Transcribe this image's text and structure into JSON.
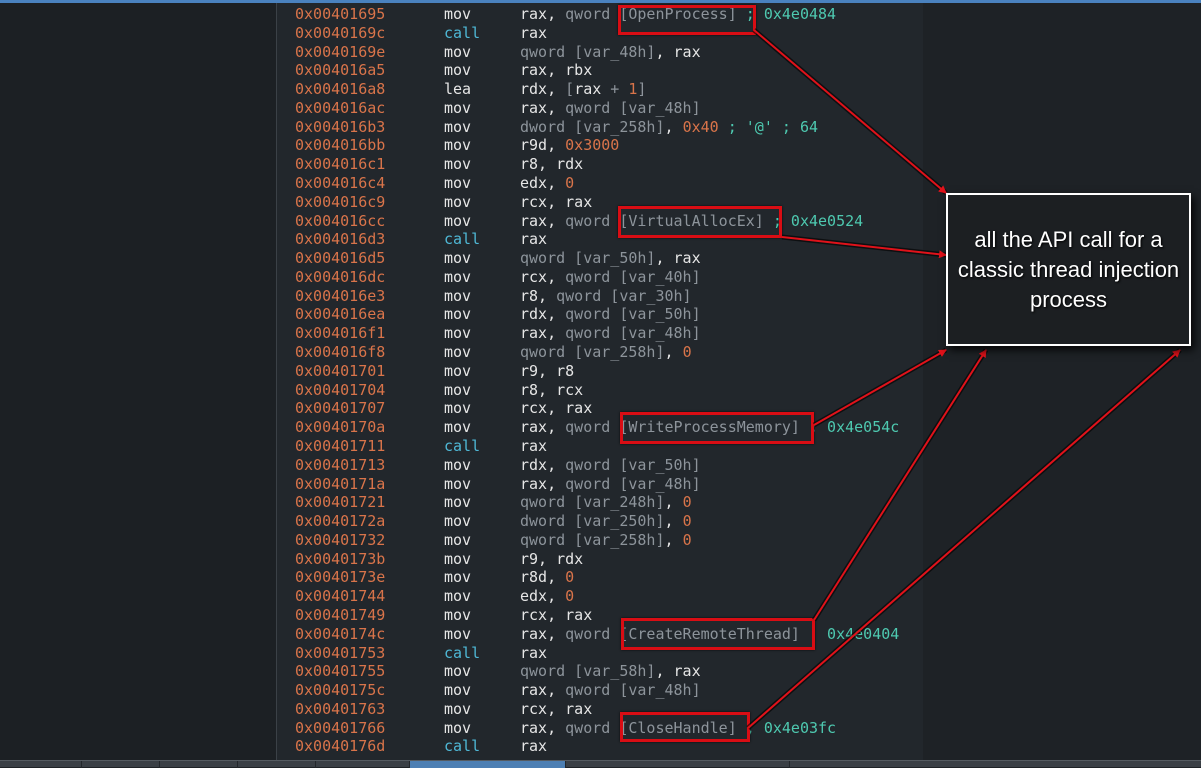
{
  "colors": {
    "address": "#d9744a",
    "mnemonic": "#e6e6e6",
    "call_mnemonic": "#4fb8d6",
    "size_keyword": "#8d949b",
    "comment": "#4ec9b0",
    "annotation_red": "#d90d14"
  },
  "annotation": {
    "text": "all the API call for a classic thread injection process"
  },
  "lines": [
    {
      "addr": "0x00401695",
      "mn": "mov",
      "ops": [
        {
          "t": "rax, ",
          "c": "op"
        },
        {
          "t": "qword ",
          "c": "kw"
        },
        {
          "t": "[OpenProcess]",
          "c": "kw"
        },
        {
          "t": " ; 0x4e0484",
          "c": "cm"
        }
      ]
    },
    {
      "addr": "0x0040169c",
      "mn": "call",
      "ops": [
        {
          "t": "rax",
          "c": "op"
        }
      ]
    },
    {
      "addr": "0x0040169e",
      "mn": "mov",
      "ops": [
        {
          "t": "qword [var_48h]",
          "c": "kw"
        },
        {
          "t": ", rax",
          "c": "op"
        }
      ]
    },
    {
      "addr": "0x004016a5",
      "mn": "mov",
      "ops": [
        {
          "t": "rax, rbx",
          "c": "op"
        }
      ]
    },
    {
      "addr": "0x004016a8",
      "mn": "lea",
      "ops": [
        {
          "t": "rdx, ",
          "c": "op"
        },
        {
          "t": "[",
          "c": "kw"
        },
        {
          "t": "rax",
          "c": "op"
        },
        {
          "t": " + ",
          "c": "kw"
        },
        {
          "t": "1",
          "c": "num"
        },
        {
          "t": "]",
          "c": "kw"
        }
      ]
    },
    {
      "addr": "0x004016ac",
      "mn": "mov",
      "ops": [
        {
          "t": "rax, ",
          "c": "op"
        },
        {
          "t": "qword [var_48h]",
          "c": "kw"
        }
      ]
    },
    {
      "addr": "0x004016b3",
      "mn": "mov",
      "ops": [
        {
          "t": "dword [var_258h]",
          "c": "kw"
        },
        {
          "t": ", ",
          "c": "op"
        },
        {
          "t": "0x40",
          "c": "num"
        },
        {
          "t": " ; '@' ; 64",
          "c": "cm"
        }
      ]
    },
    {
      "addr": "0x004016bb",
      "mn": "mov",
      "ops": [
        {
          "t": "r9d, ",
          "c": "op"
        },
        {
          "t": "0x3000",
          "c": "num"
        }
      ]
    },
    {
      "addr": "0x004016c1",
      "mn": "mov",
      "ops": [
        {
          "t": "r8, rdx",
          "c": "op"
        }
      ]
    },
    {
      "addr": "0x004016c4",
      "mn": "mov",
      "ops": [
        {
          "t": "edx, ",
          "c": "op"
        },
        {
          "t": "0",
          "c": "num"
        }
      ]
    },
    {
      "addr": "0x004016c9",
      "mn": "mov",
      "ops": [
        {
          "t": "rcx, rax",
          "c": "op"
        }
      ]
    },
    {
      "addr": "0x004016cc",
      "mn": "mov",
      "ops": [
        {
          "t": "rax, ",
          "c": "op"
        },
        {
          "t": "qword ",
          "c": "kw"
        },
        {
          "t": "[VirtualAllocEx]",
          "c": "kw"
        },
        {
          "t": " ; 0x4e0524",
          "c": "cm"
        }
      ]
    },
    {
      "addr": "0x004016d3",
      "mn": "call",
      "ops": [
        {
          "t": "rax",
          "c": "op"
        }
      ]
    },
    {
      "addr": "0x004016d5",
      "mn": "mov",
      "ops": [
        {
          "t": "qword [var_50h]",
          "c": "kw"
        },
        {
          "t": ", rax",
          "c": "op"
        }
      ]
    },
    {
      "addr": "0x004016dc",
      "mn": "mov",
      "ops": [
        {
          "t": "rcx, ",
          "c": "op"
        },
        {
          "t": "qword [var_40h]",
          "c": "kw"
        }
      ]
    },
    {
      "addr": "0x004016e3",
      "mn": "mov",
      "ops": [
        {
          "t": "r8, ",
          "c": "op"
        },
        {
          "t": "qword [var_30h]",
          "c": "kw"
        }
      ]
    },
    {
      "addr": "0x004016ea",
      "mn": "mov",
      "ops": [
        {
          "t": "rdx, ",
          "c": "op"
        },
        {
          "t": "qword [var_50h]",
          "c": "kw"
        }
      ]
    },
    {
      "addr": "0x004016f1",
      "mn": "mov",
      "ops": [
        {
          "t": "rax, ",
          "c": "op"
        },
        {
          "t": "qword [var_48h]",
          "c": "kw"
        }
      ]
    },
    {
      "addr": "0x004016f8",
      "mn": "mov",
      "ops": [
        {
          "t": "qword [var_258h]",
          "c": "kw"
        },
        {
          "t": ", ",
          "c": "op"
        },
        {
          "t": "0",
          "c": "num"
        }
      ]
    },
    {
      "addr": "0x00401701",
      "mn": "mov",
      "ops": [
        {
          "t": "r9, r8",
          "c": "op"
        }
      ]
    },
    {
      "addr": "0x00401704",
      "mn": "mov",
      "ops": [
        {
          "t": "r8, rcx",
          "c": "op"
        }
      ]
    },
    {
      "addr": "0x00401707",
      "mn": "mov",
      "ops": [
        {
          "t": "rcx, rax",
          "c": "op"
        }
      ]
    },
    {
      "addr": "0x0040170a",
      "mn": "mov",
      "ops": [
        {
          "t": "rax, ",
          "c": "op"
        },
        {
          "t": "qword ",
          "c": "kw"
        },
        {
          "t": "[WriteProcessMemory]",
          "c": "kw"
        },
        {
          "t": " ; 0x4e054c",
          "c": "cm"
        }
      ]
    },
    {
      "addr": "0x00401711",
      "mn": "call",
      "ops": [
        {
          "t": "rax",
          "c": "op"
        }
      ]
    },
    {
      "addr": "0x00401713",
      "mn": "mov",
      "ops": [
        {
          "t": "rdx, ",
          "c": "op"
        },
        {
          "t": "qword [var_50h]",
          "c": "kw"
        }
      ]
    },
    {
      "addr": "0x0040171a",
      "mn": "mov",
      "ops": [
        {
          "t": "rax, ",
          "c": "op"
        },
        {
          "t": "qword [var_48h]",
          "c": "kw"
        }
      ]
    },
    {
      "addr": "0x00401721",
      "mn": "mov",
      "ops": [
        {
          "t": "qword [var_248h]",
          "c": "kw"
        },
        {
          "t": ", ",
          "c": "op"
        },
        {
          "t": "0",
          "c": "num"
        }
      ]
    },
    {
      "addr": "0x0040172a",
      "mn": "mov",
      "ops": [
        {
          "t": "dword [var_250h]",
          "c": "kw"
        },
        {
          "t": ", ",
          "c": "op"
        },
        {
          "t": "0",
          "c": "num"
        }
      ]
    },
    {
      "addr": "0x00401732",
      "mn": "mov",
      "ops": [
        {
          "t": "qword [var_258h]",
          "c": "kw"
        },
        {
          "t": ", ",
          "c": "op"
        },
        {
          "t": "0",
          "c": "num"
        }
      ]
    },
    {
      "addr": "0x0040173b",
      "mn": "mov",
      "ops": [
        {
          "t": "r9, rdx",
          "c": "op"
        }
      ]
    },
    {
      "addr": "0x0040173e",
      "mn": "mov",
      "ops": [
        {
          "t": "r8d, ",
          "c": "op"
        },
        {
          "t": "0",
          "c": "num"
        }
      ]
    },
    {
      "addr": "0x00401744",
      "mn": "mov",
      "ops": [
        {
          "t": "edx, ",
          "c": "op"
        },
        {
          "t": "0",
          "c": "num"
        }
      ]
    },
    {
      "addr": "0x00401749",
      "mn": "mov",
      "ops": [
        {
          "t": "rcx, rax",
          "c": "op"
        }
      ]
    },
    {
      "addr": "0x0040174c",
      "mn": "mov",
      "ops": [
        {
          "t": "rax, ",
          "c": "op"
        },
        {
          "t": "qword ",
          "c": "kw"
        },
        {
          "t": "[CreateRemoteThread]",
          "c": "kw"
        },
        {
          "t": " ; 0x4e0404",
          "c": "cm"
        }
      ]
    },
    {
      "addr": "0x00401753",
      "mn": "call",
      "ops": [
        {
          "t": "rax",
          "c": "op"
        }
      ]
    },
    {
      "addr": "0x00401755",
      "mn": "mov",
      "ops": [
        {
          "t": "qword [var_58h]",
          "c": "kw"
        },
        {
          "t": ", rax",
          "c": "op"
        }
      ]
    },
    {
      "addr": "0x0040175c",
      "mn": "mov",
      "ops": [
        {
          "t": "rax, ",
          "c": "op"
        },
        {
          "t": "qword [var_48h]",
          "c": "kw"
        }
      ]
    },
    {
      "addr": "0x00401763",
      "mn": "mov",
      "ops": [
        {
          "t": "rcx, rax",
          "c": "op"
        }
      ]
    },
    {
      "addr": "0x00401766",
      "mn": "mov",
      "ops": [
        {
          "t": "rax, ",
          "c": "op"
        },
        {
          "t": "qword ",
          "c": "kw"
        },
        {
          "t": "[CloseHandle]",
          "c": "kw"
        },
        {
          "t": " ; 0x4e03fc",
          "c": "cm"
        }
      ]
    },
    {
      "addr": "0x0040176d",
      "mn": "call",
      "ops": [
        {
          "t": "rax",
          "c": "op"
        }
      ]
    }
  ]
}
